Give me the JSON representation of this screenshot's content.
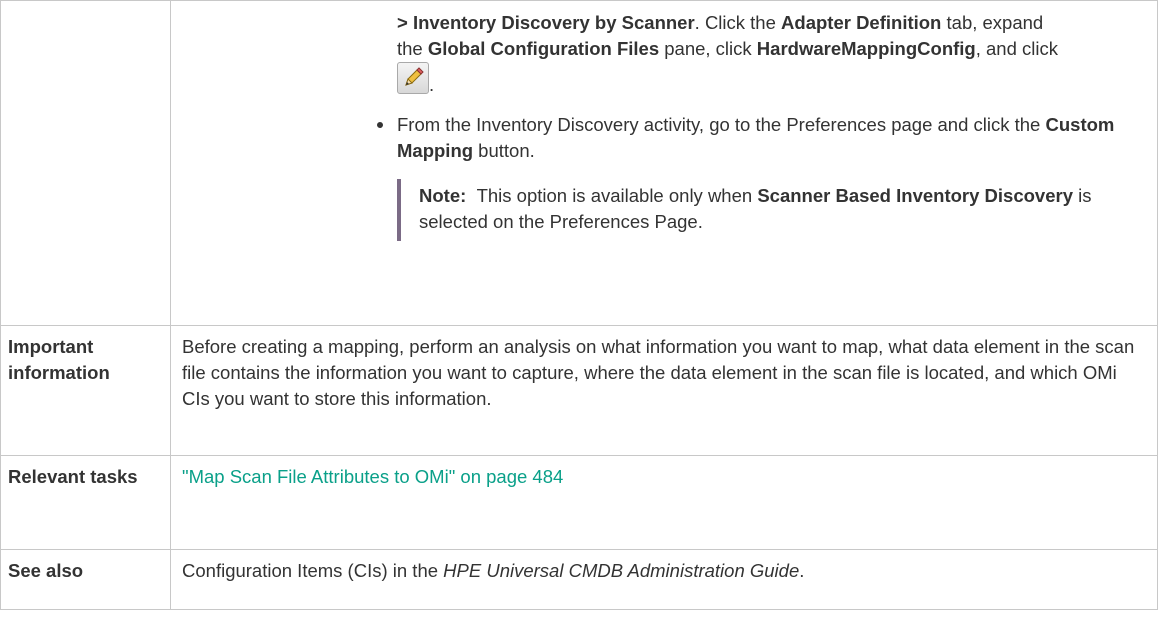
{
  "row_continuation": {
    "line1_bold": "> Inventory Discovery by Scanner",
    "line1_text1": ". Click the ",
    "line1_bold2": "Adapter Definition",
    "line1_text2": " tab, expand",
    "line2_text1": "the ",
    "line2_bold1": "Global Configuration Files",
    "line2_text2": " pane, click ",
    "line2_bold2": "HardwareMappingConfig",
    "line2_text3": ", and click",
    "icon": "pencil-edit-icon",
    "after_icon": ".",
    "bullet_text1": "From the Inventory Discovery activity, go to the Preferences page and click the ",
    "bullet_bold": "Custom Mapping",
    "bullet_text2": " button.",
    "note_label": "Note:",
    "note_text1": "This option is available only when ",
    "note_bold": "Scanner Based Inventory Discovery",
    "note_text2": " is selected on the Preferences Page."
  },
  "rows": [
    {
      "label": "Important information",
      "text": "Before creating a mapping, perform an analysis on what information you want to map, what data element in the scan file contains the information you want to capture, where the data element in the scan file is located, and which OMi CIs you want to store this information."
    },
    {
      "label": "Relevant tasks",
      "link": "\"Map Scan File Attributes to OMi\" on page 484"
    },
    {
      "label": "See also",
      "text1": "Configuration Items (CIs) in the ",
      "italic": "HPE Universal CMDB Administration Guide",
      "text2": "."
    }
  ]
}
